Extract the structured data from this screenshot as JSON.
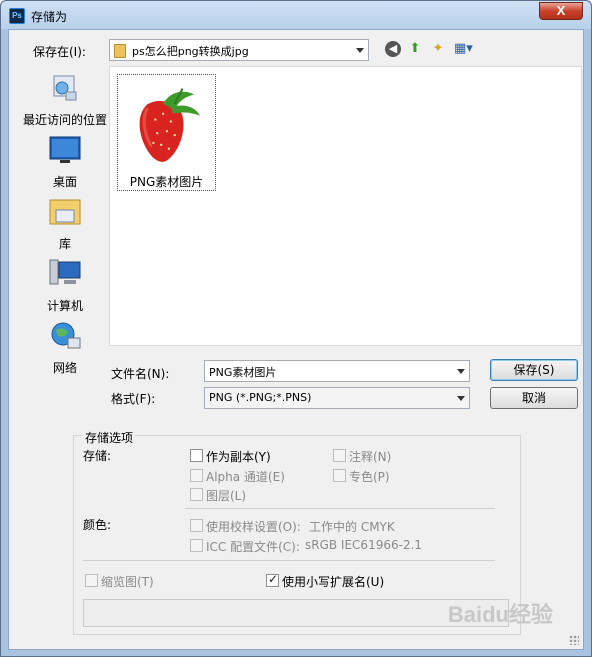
{
  "window": {
    "title": "存储为",
    "app_icon": "Ps",
    "close_label": "X"
  },
  "save_in": {
    "label": "保存在(I):",
    "value": "ps怎么把png转换成jpg"
  },
  "toolbar": {
    "icons": [
      "back-arrow-icon",
      "up-folder-icon",
      "new-folder-icon",
      "view-menu-icon"
    ]
  },
  "places": [
    {
      "label": "最近访问的位置",
      "icon": "recent-places-icon"
    },
    {
      "label": "桌面",
      "icon": "desktop-icon"
    },
    {
      "label": "库",
      "icon": "libraries-icon"
    },
    {
      "label": "计算机",
      "icon": "computer-icon"
    },
    {
      "label": "网络",
      "icon": "network-icon"
    }
  ],
  "files": [
    {
      "name": "PNG素材图片",
      "thumbnail": "strawberry-image"
    }
  ],
  "filename": {
    "label": "文件名(N):",
    "value": "PNG素材图片"
  },
  "format": {
    "label": "格式(F):",
    "value": "PNG (*.PNG;*.PNS)"
  },
  "buttons": {
    "save": "保存(S)",
    "cancel": "取消"
  },
  "options": {
    "group_title": "存储选项",
    "storage_label": "存储:",
    "as_copy": "作为副本(Y)",
    "alpha": "Alpha 通道(E)",
    "layers": "图层(L)",
    "notes": "注释(N)",
    "spot": "专色(P)",
    "color_label": "颜色:",
    "proof": "使用校样设置(O):",
    "proof_value": "工作中的 CMYK",
    "icc": "ICC 配置文件(C):",
    "icc_value": "sRGB IEC61966-2.1",
    "thumbnail": "缩览图(T)",
    "lowercase_ext": "使用小写扩展名(U)"
  },
  "states": {
    "as_copy_checked": false,
    "lowercase_ext_checked": true
  },
  "watermark": "Baidu经验"
}
